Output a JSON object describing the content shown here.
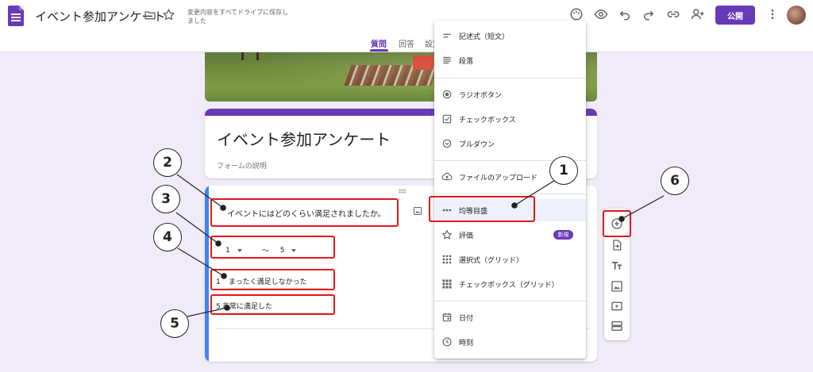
{
  "header": {
    "doc_title": "イベント参加アンケート",
    "save_status": "変更内容をすべてドライブに保存しました",
    "publish_label": "公開",
    "icons": [
      "folder-icon",
      "star-icon",
      "palette-icon",
      "preview-eye-icon",
      "undo-icon",
      "redo-icon",
      "link-icon",
      "add-collaborator-icon",
      "more-vert-icon"
    ],
    "tabs": [
      {
        "label": "質問",
        "active": true
      },
      {
        "label": "回答",
        "active": false
      },
      {
        "label": "設定",
        "active": false
      }
    ]
  },
  "form": {
    "title": "イベント参加アンケート",
    "description": "フォームの説明"
  },
  "question": {
    "text": "イベントにはどのくらい満足されましたか。",
    "scale_min": "1",
    "scale_sep": "〜",
    "scale_max": "5",
    "low_label_num": "1",
    "low_label": "まったく満足しなかった",
    "high_label_num": "5",
    "high_label": "非常に満足した"
  },
  "menu": {
    "items": [
      {
        "label": "記述式（短文）",
        "icon": "short-answer-icon"
      },
      {
        "label": "段落",
        "icon": "paragraph-icon"
      },
      {
        "label": "ラジオボタン",
        "icon": "radio-button-icon"
      },
      {
        "label": "チェックボックス",
        "icon": "checkbox-icon"
      },
      {
        "label": "プルダウン",
        "icon": "dropdown-icon"
      },
      {
        "label": "ファイルのアップロード",
        "icon": "cloud-upload-icon"
      },
      {
        "label": "均等目盛",
        "icon": "linear-scale-icon",
        "selected": true
      },
      {
        "label": "評価",
        "icon": "star-rating-icon",
        "badge": "新規"
      },
      {
        "label": "選択式（グリッド）",
        "icon": "multiple-choice-grid-icon"
      },
      {
        "label": "チェックボックス（グリッド）",
        "icon": "checkbox-grid-icon"
      },
      {
        "label": "日付",
        "icon": "calendar-icon"
      },
      {
        "label": "時刻",
        "icon": "clock-icon"
      }
    ]
  },
  "side_toolbar": {
    "icons": [
      "add-question-icon",
      "import-questions-icon",
      "add-title-icon",
      "add-image-icon",
      "add-video-icon",
      "add-section-icon"
    ]
  },
  "annotations": {
    "labels": [
      "1",
      "2",
      "3",
      "4",
      "5",
      "6"
    ],
    "highlight_color": "#e5161b"
  },
  "colors": {
    "accent": "#673ab7",
    "active_question": "#4285f4",
    "background": "#f0ebf8"
  }
}
